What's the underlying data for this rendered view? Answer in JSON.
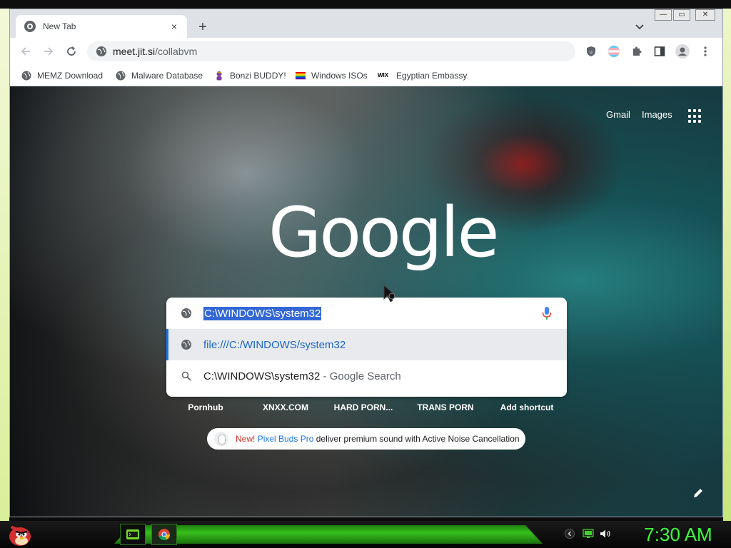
{
  "browser": {
    "tab": {
      "title": "New Tab",
      "close": "×"
    },
    "new_tab": "+",
    "window_controls": {
      "minimize": "—",
      "restore": "▭",
      "close": "✕"
    },
    "address": {
      "host": "meet.jit.si",
      "path": "/collabvm"
    },
    "bookmarks": [
      {
        "label": "MEMZ Download",
        "icon": "globe-icon"
      },
      {
        "label": "Malware Database",
        "icon": "globe-icon"
      },
      {
        "label": "Bonzi BUDDY!",
        "icon": "bonzi-icon"
      },
      {
        "label": "Windows ISOs",
        "icon": "rainbow-flag-icon"
      },
      {
        "label": "Egyptian Embassy",
        "icon": "wix-icon",
        "icon_text": "WIX"
      }
    ]
  },
  "ntp": {
    "gmail": "Gmail",
    "images": "Images",
    "logo": "Google",
    "search": {
      "query": "C:\\WINDOWS\\system32",
      "suggestions": [
        {
          "text": "file:///C:/WINDOWS/system32",
          "icon": "globe-icon"
        },
        {
          "text": "C:\\WINDOWS\\system32",
          "suffix": " - Google Search",
          "icon": "search-icon"
        }
      ]
    },
    "shortcuts": [
      "Pornhub",
      "XNXX.COM",
      "HARD PORN...",
      "TRANS PORN",
      "Add shortcut"
    ],
    "promo": {
      "new": "New!",
      "product": "Pixel Buds Pro",
      "text": "deliver premium sound with Active Noise Cancellation"
    }
  },
  "taskbar": {
    "clock": "7:30 AM",
    "apps": [
      "terminal-app-icon",
      "chrome-app-icon"
    ]
  },
  "colors": {
    "accent": "#1a73e8",
    "selection": "#3367d6",
    "clock": "#3cff3c",
    "taskbar_glow": "#39d41c"
  }
}
